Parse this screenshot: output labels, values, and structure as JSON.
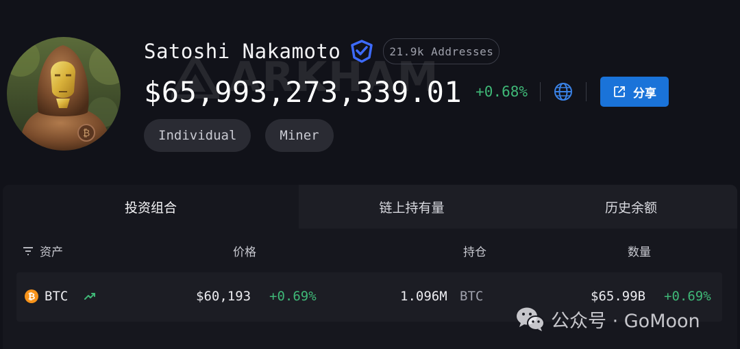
{
  "entity": {
    "name": "Satoshi Nakamoto",
    "addresses": "21.9k Addresses",
    "total_value": "$65,993,273,339.01",
    "change": "+0.68%",
    "share_label": "分享",
    "tags": [
      "Individual",
      "Miner"
    ]
  },
  "watermark": {
    "brand": "ARKHAM"
  },
  "tabs": [
    {
      "label": "投资组合",
      "active": true
    },
    {
      "label": "链上持有量",
      "active": false
    },
    {
      "label": "历史余额",
      "active": false
    }
  ],
  "table": {
    "headers": {
      "asset": "资产",
      "price": "价格",
      "holdings": "持仓",
      "amount": "数量"
    },
    "rows": [
      {
        "asset": "BTC",
        "price": "$60,193",
        "price_change": "+0.69%",
        "holdings": "1.096M",
        "holdings_unit": "BTC",
        "amount": "$65.99B",
        "amount_change": "+0.69%"
      }
    ]
  },
  "footer_watermark": {
    "text": "公众号 · GoMoon"
  },
  "colors": {
    "accent": "#1a73d9",
    "positive": "#3fb877",
    "verified": "#3d6bff",
    "bitcoin": "#f7931a"
  },
  "icons": [
    "verified-badge-icon",
    "globe-icon",
    "external-link-icon",
    "filter-icon",
    "bitcoin-icon",
    "trend-up-icon",
    "wechat-icon"
  ]
}
